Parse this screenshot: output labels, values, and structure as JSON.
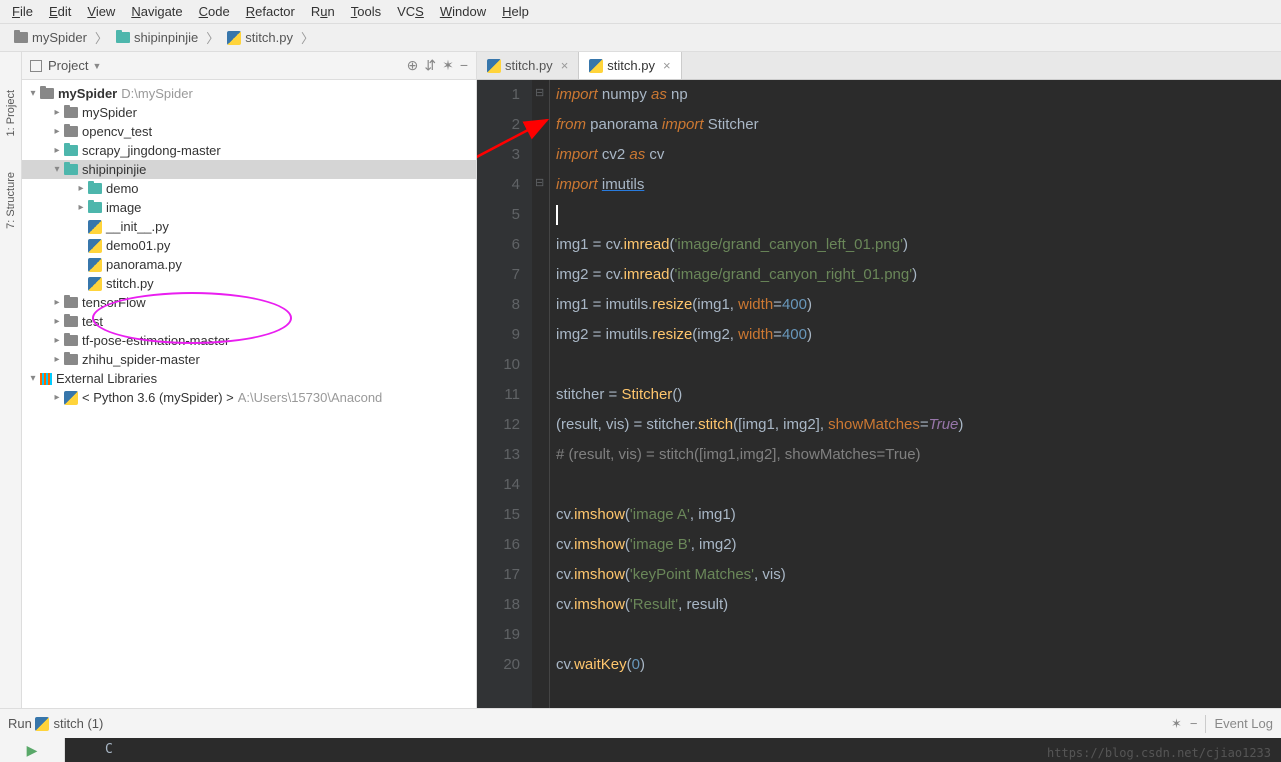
{
  "menu": {
    "items": [
      "File",
      "Edit",
      "View",
      "Navigate",
      "Code",
      "Refactor",
      "Run",
      "Tools",
      "VCS",
      "Window",
      "Help"
    ],
    "underlines": [
      "F",
      "E",
      "V",
      "N",
      "C",
      "R",
      "u",
      "T",
      "S",
      "W",
      "H"
    ]
  },
  "breadcrumb": {
    "root": "mySpider",
    "mid": "shipinpinjie",
    "file": "stitch.py"
  },
  "sidebar_tabs": {
    "project": "1: Project",
    "structure": "7: Structure"
  },
  "panel": {
    "title": "Project",
    "icons": [
      "target",
      "collapse",
      "gear",
      "hide"
    ]
  },
  "tree": {
    "root": {
      "name": "mySpider",
      "path": "D:\\mySpider"
    },
    "children": [
      {
        "name": "mySpider",
        "depth": 1,
        "icon": "folder",
        "arrow": "right"
      },
      {
        "name": "opencv_test",
        "depth": 1,
        "icon": "folder",
        "arrow": "right"
      },
      {
        "name": "scrapy_jingdong-master",
        "depth": 1,
        "icon": "folder-teal",
        "arrow": "right"
      },
      {
        "name": "shipinpinjie",
        "depth": 1,
        "icon": "folder-teal",
        "arrow": "down",
        "selected": true
      },
      {
        "name": "demo",
        "depth": 2,
        "icon": "folder-teal",
        "arrow": "right"
      },
      {
        "name": "image",
        "depth": 2,
        "icon": "folder-teal",
        "arrow": "right"
      },
      {
        "name": "__init__.py",
        "depth": 2,
        "icon": "py",
        "arrow": ""
      },
      {
        "name": "demo01.py",
        "depth": 2,
        "icon": "py",
        "arrow": ""
      },
      {
        "name": "panorama.py",
        "depth": 2,
        "icon": "py",
        "arrow": ""
      },
      {
        "name": "stitch.py",
        "depth": 2,
        "icon": "py",
        "arrow": ""
      },
      {
        "name": "tensorFlow",
        "depth": 1,
        "icon": "folder",
        "arrow": "right"
      },
      {
        "name": "test",
        "depth": 1,
        "icon": "folder",
        "arrow": "right"
      },
      {
        "name": "tf-pose-estimation-master",
        "depth": 1,
        "icon": "folder",
        "arrow": "right"
      },
      {
        "name": "zhihu_spider-master",
        "depth": 1,
        "icon": "folder",
        "arrow": "right"
      }
    ],
    "external": {
      "name": "External Libraries",
      "child": "< Python 3.6 (mySpider) >",
      "child_path": "A:\\Users\\15730\\Anacond"
    }
  },
  "editor_tabs": [
    {
      "name": "stitch.py",
      "active": false
    },
    {
      "name": "stitch.py",
      "active": true
    }
  ],
  "code": {
    "lines": [
      {
        "n": 1,
        "tokens": [
          [
            "kw",
            "import"
          ],
          [
            "",
            " numpy "
          ],
          [
            "kw",
            "as"
          ],
          [
            "",
            " np"
          ]
        ]
      },
      {
        "n": 2,
        "tokens": [
          [
            "kw",
            "from"
          ],
          [
            "",
            " panorama "
          ],
          [
            "kw",
            "import"
          ],
          [
            "",
            " "
          ],
          [
            "cls",
            "Stitcher"
          ]
        ]
      },
      {
        "n": 3,
        "tokens": [
          [
            "kw",
            "import"
          ],
          [
            "",
            " cv2 "
          ],
          [
            "kw",
            "as"
          ],
          [
            "",
            " cv"
          ]
        ]
      },
      {
        "n": 4,
        "tokens": [
          [
            "kw",
            "import"
          ],
          [
            "",
            " "
          ],
          [
            "underline",
            "imutils"
          ]
        ]
      },
      {
        "n": 5,
        "tokens": []
      },
      {
        "n": 6,
        "tokens": [
          [
            "",
            "img1 = cv."
          ],
          [
            "fn",
            "imread"
          ],
          [
            "",
            "("
          ],
          [
            "str",
            "'image/grand_canyon_left_01.png'"
          ],
          [
            "",
            ")"
          ]
        ]
      },
      {
        "n": 7,
        "tokens": [
          [
            "",
            "img2 = cv."
          ],
          [
            "fn",
            "imread"
          ],
          [
            "",
            "("
          ],
          [
            "str",
            "'image/grand_canyon_right_01.png'"
          ],
          [
            "",
            ")"
          ]
        ]
      },
      {
        "n": 8,
        "tokens": [
          [
            "",
            "img1 = imutils."
          ],
          [
            "fn",
            "resize"
          ],
          [
            "",
            "(img1, "
          ],
          [
            "prm",
            "width"
          ],
          [
            "",
            "="
          ],
          [
            "num",
            "400"
          ],
          [
            "",
            ")"
          ]
        ]
      },
      {
        "n": 9,
        "tokens": [
          [
            "",
            "img2 = imutils."
          ],
          [
            "fn",
            "resize"
          ],
          [
            "",
            "(img2, "
          ],
          [
            "prm",
            "width"
          ],
          [
            "",
            "="
          ],
          [
            "num",
            "400"
          ],
          [
            "",
            ")"
          ]
        ]
      },
      {
        "n": 10,
        "tokens": []
      },
      {
        "n": 11,
        "tokens": [
          [
            "",
            "stitcher = "
          ],
          [
            "fn",
            "Stitcher"
          ],
          [
            "",
            "()"
          ]
        ]
      },
      {
        "n": 12,
        "tokens": [
          [
            "",
            "(result, vis) = stitcher."
          ],
          [
            "fn",
            "stitch"
          ],
          [
            "",
            "([img1, img2], "
          ],
          [
            "prm",
            "showMatches"
          ],
          [
            "",
            "="
          ],
          [
            "const",
            "True"
          ],
          [
            "",
            ")"
          ]
        ]
      },
      {
        "n": 13,
        "tokens": [
          [
            "cmt",
            "# (result, vis) = stitch([img1,img2], showMatches=True)"
          ]
        ]
      },
      {
        "n": 14,
        "tokens": []
      },
      {
        "n": 15,
        "tokens": [
          [
            "",
            "cv."
          ],
          [
            "fn",
            "imshow"
          ],
          [
            "",
            "("
          ],
          [
            "str",
            "'image A'"
          ],
          [
            "",
            ", img1)"
          ]
        ]
      },
      {
        "n": 16,
        "tokens": [
          [
            "",
            "cv."
          ],
          [
            "fn",
            "imshow"
          ],
          [
            "",
            "("
          ],
          [
            "str",
            "'image B'"
          ],
          [
            "",
            ", img2)"
          ]
        ]
      },
      {
        "n": 17,
        "tokens": [
          [
            "",
            "cv."
          ],
          [
            "fn",
            "imshow"
          ],
          [
            "",
            "("
          ],
          [
            "str",
            "'keyPoint Matches'"
          ],
          [
            "",
            ", vis)"
          ]
        ]
      },
      {
        "n": 18,
        "tokens": [
          [
            "",
            "cv."
          ],
          [
            "fn",
            "imshow"
          ],
          [
            "",
            "("
          ],
          [
            "str",
            "'Result'"
          ],
          [
            "",
            ", result)"
          ]
        ]
      },
      {
        "n": 19,
        "tokens": []
      },
      {
        "n": 20,
        "tokens": [
          [
            "",
            "cv."
          ],
          [
            "fn",
            "waitKey"
          ],
          [
            "",
            "("
          ],
          [
            "num",
            "0"
          ],
          [
            "",
            ")"
          ]
        ]
      }
    ]
  },
  "run_panel": {
    "label_prefix": "Run",
    "label": "stitch",
    "count": "(1)",
    "event_log": "Event Log"
  },
  "terminal": {
    "text": "C"
  },
  "watermark": "https://blog.csdn.net/cjiao1233"
}
